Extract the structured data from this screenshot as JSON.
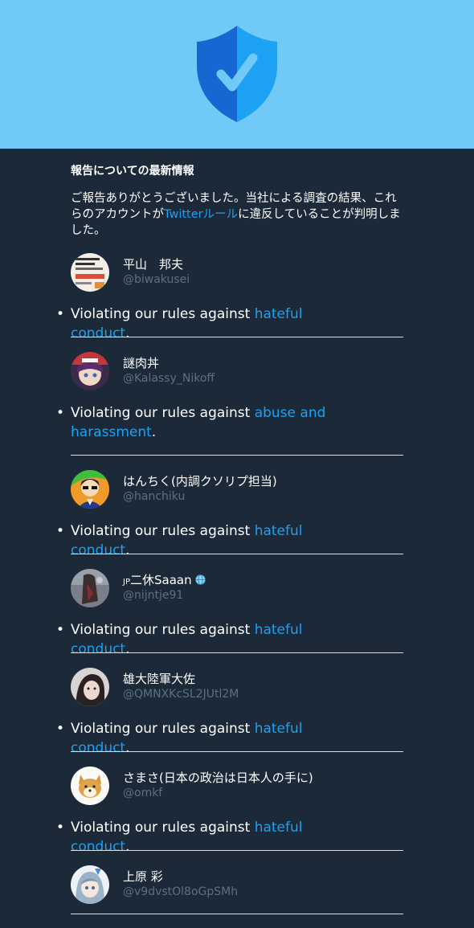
{
  "header": {
    "icon": "shield-check-icon",
    "background": "#71c9f8",
    "shield_colors": [
      "#1767d2",
      "#1da1f2",
      "#71c9f8"
    ]
  },
  "report": {
    "heading": "報告についての最新情報",
    "intro_before": "ご報告ありがとうございました。当社による調査の結果、これらのアカウントが",
    "rules_link": "Twitterルール",
    "intro_after": "に違反していることが判明しました。"
  },
  "violation_prefix": "Violating our rules against ",
  "accounts": [
    {
      "name": "平山　邦夫",
      "handle": "@biwakusei",
      "reason": "hateful conduct",
      "avatar": "book-cover-avatar"
    },
    {
      "name": "謎肉丼",
      "handle": "@Kalassy_Nikoff",
      "reason": "abuse and harassment",
      "avatar": "anime-girl-avatar"
    },
    {
      "name": "はんちく(内調クソリプ担当)",
      "handle": "@hanchiku",
      "reason": "hateful conduct",
      "avatar": "cartoon-man-avatar"
    },
    {
      "name": "JP二休Saaan",
      "name_prefix": "JP",
      "name_main": "二休Saaan",
      "badge": "globe-icon",
      "handle": "@nijntje91",
      "reason": "hateful conduct",
      "avatar": "dark-figure-avatar"
    },
    {
      "name": "雄大陸軍大佐",
      "handle": "@QMNXKcSL2JUtl2M",
      "reason": "hateful conduct",
      "avatar": "portrait-avatar"
    },
    {
      "name": "さまさ(日本の政治は日本人の手に)",
      "handle": "@omkf",
      "reason": "hateful conduct",
      "avatar": "shiba-dog-avatar"
    },
    {
      "name": "上原 彩",
      "handle": "@v9dvstOl8oGpSMh",
      "reason": "",
      "avatar": "anime-character-avatar"
    }
  ],
  "colors": {
    "background": "#1c2938",
    "link": "#1da1f2",
    "muted_text": "#5b7083",
    "divider": "#d8dde2"
  }
}
